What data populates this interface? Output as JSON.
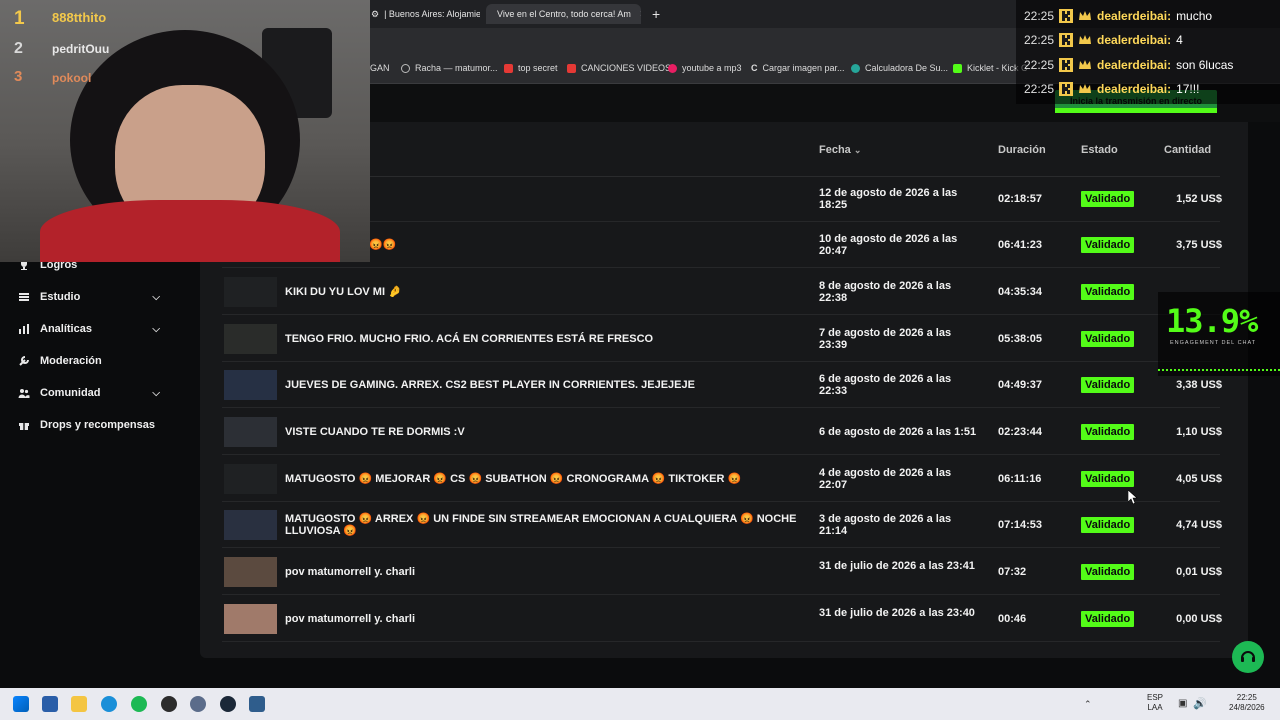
{
  "browser": {
    "tabs": [
      {
        "label": "| Buenos Aires: Alojamien",
        "icon": "airbnb-icon"
      },
      {
        "label": "Vive en el Centro, todo cerca! Am",
        "icon": "airbnb-icon"
      }
    ],
    "new_tab": "+",
    "bookmarks": [
      {
        "label": "GAN",
        "color": "#cccccc"
      },
      {
        "label": "Racha — matumor...",
        "color": "#9e9e9e"
      },
      {
        "label": "top secret",
        "color": "#e53935"
      },
      {
        "label": "CANCIONES VIDEOS",
        "color": "#e53935"
      },
      {
        "label": "youtube a mp3",
        "color": "#e91e63"
      },
      {
        "label": "Cargar imagen par...",
        "color": "#cfcfcf"
      },
      {
        "label": "Calculadora De Su...",
        "color": "#26a69a"
      },
      {
        "label": "Kicklet - Kick C",
        "color": "#53fc18"
      }
    ]
  },
  "live_button": "Inicia la transmisión en directo",
  "sidebar": {
    "items": [
      {
        "label": "Logros",
        "icon": "trophy-icon",
        "expandable": false
      },
      {
        "label": "Estudio",
        "icon": "studio-icon",
        "expandable": true
      },
      {
        "label": "Analíticas",
        "icon": "chart-icon",
        "expandable": true
      },
      {
        "label": "Moderación",
        "icon": "wrench-icon",
        "expandable": false
      },
      {
        "label": "Comunidad",
        "icon": "community-icon",
        "expandable": true
      },
      {
        "label": "Drops y recompensas",
        "icon": "gift-icon",
        "expandable": false
      }
    ]
  },
  "table": {
    "headers": {
      "date": "Fecha",
      "duration": "Duración",
      "status": "Estado",
      "amount": "Cantidad"
    },
    "rows": [
      {
        "title": "",
        "date": "12 de agosto de 2026 a las 18:25",
        "duration": "02:18:57",
        "status": "Validado",
        "amount": "1,52 US$"
      },
      {
        "title": "ME LA SUBE 😡😡😡",
        "date": "10 de agosto de 2026 a las 20:47",
        "duration": "06:41:23",
        "status": "Validado",
        "amount": "3,75 US$"
      },
      {
        "title": "KIKI DU YU LOV MI 🤌",
        "date": "8 de agosto de 2026 a las 22:38",
        "duration": "04:35:34",
        "status": "Validado",
        "amount": ""
      },
      {
        "title": "TENGO FRIO. MUCHO FRIO. ACÁ EN CORRIENTES ESTÁ RE FRESCO",
        "date": "7 de agosto de 2026 a las 23:39",
        "duration": "05:38:05",
        "status": "Validado",
        "amount": ""
      },
      {
        "title": "JUEVES DE GAMING. ARREX. CS2 BEST PLAYER IN CORRIENTES. JEJEJEJE",
        "date": "6 de agosto de 2026 a las 22:33",
        "duration": "04:49:37",
        "status": "Validado",
        "amount": "3,38 US$"
      },
      {
        "title": "VISTE CUANDO TE RE DORMIS :V",
        "date": "6 de agosto de 2026 a las 1:51",
        "duration": "02:23:44",
        "status": "Validado",
        "amount": "1,10 US$"
      },
      {
        "title": "MATUGOSTO 😡 MEJORAR 😡 CS 😡 SUBATHON 😡 CRONOGRAMA 😡 TIKTOKER 😡",
        "date": "4 de agosto de 2026 a las 22:07",
        "duration": "06:11:16",
        "status": "Validado",
        "amount": "4,05 US$"
      },
      {
        "title": "MATUGOSTO 😡 ARREX 😡 UN FINDE SIN STREAMEAR EMOCIONAN A CUALQUIERA 😡 NOCHE LLUVIOSA 😡",
        "date": "3 de agosto de 2026 a las 21:14",
        "duration": "07:14:53",
        "status": "Validado",
        "amount": "4,74 US$"
      },
      {
        "title": "pov matumorrell y. charli",
        "date": "31 de julio de 2026 a las 23:41",
        "duration": "07:32",
        "status": "Validado",
        "amount": "0,01 US$"
      },
      {
        "title": "pov matumorrell y. charli",
        "date": "31 de julio de 2026 a las 23:40",
        "duration": "00:46",
        "status": "Validado",
        "amount": "0,00 US$"
      }
    ]
  },
  "stream_overlay": {
    "ranking": [
      {
        "pos": "1",
        "name": "888tthito"
      },
      {
        "pos": "2",
        "name": "pedritOuu"
      },
      {
        "pos": "3",
        "name": "pokool"
      }
    ],
    "chat": [
      {
        "time": "22:25",
        "user": "dealerdeibai:",
        "msg": "mucho"
      },
      {
        "time": "22:25",
        "user": "dealerdeibai:",
        "msg": "4"
      },
      {
        "time": "22:25",
        "user": "dealerdeibai:",
        "msg": "son 6lucas"
      },
      {
        "time": "22:25",
        "user": "dealerdeibai:",
        "msg": "17!!!"
      }
    ],
    "engagement_value": "13.9%",
    "engagement_label": "ENGAGEMENT DEL CHAT"
  },
  "taskbar": {
    "lang": "ESP",
    "lang2": "LAA",
    "time": "22:25",
    "date": "24/8/2026"
  },
  "colors": {
    "accent": "#53fc18",
    "background": "#0b0c0d",
    "panel": "#17181a"
  }
}
